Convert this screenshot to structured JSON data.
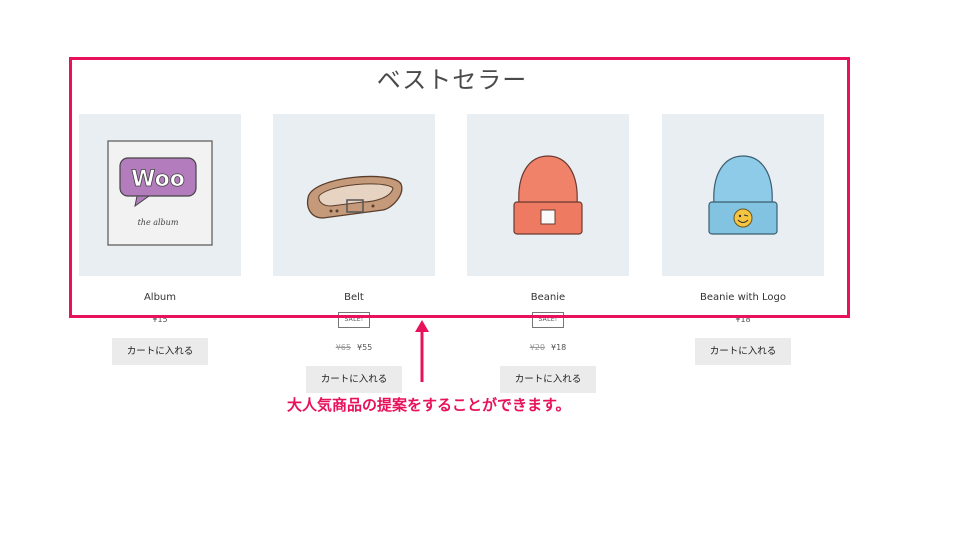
{
  "section": {
    "title": "ベストセラー"
  },
  "products": [
    {
      "name": "Album",
      "price": "¥15",
      "cart_label": "カートに入れる",
      "image_icon": "woo-album-icon"
    },
    {
      "name": "Belt",
      "sale_badge": "SALE!",
      "old_price": "¥65",
      "price": "¥55",
      "cart_label": "カートに入れる",
      "image_icon": "belt-icon"
    },
    {
      "name": "Beanie",
      "sale_badge": "SALE!",
      "old_price": "¥20",
      "price": "¥18",
      "cart_label": "カートに入れる",
      "image_icon": "beanie-orange-icon"
    },
    {
      "name": "Beanie with Logo",
      "price": "¥18",
      "cart_label": "カートに入れる",
      "image_icon": "beanie-blue-icon"
    }
  ],
  "album_art": {
    "logo_text": "Woo",
    "caption": "the album"
  },
  "annotation": {
    "text": "大人気商品の提案をすることができます。"
  },
  "colors": {
    "highlight": "#e8115b",
    "thumb_bg": "#e9eef2",
    "button_bg": "#ebebeb"
  }
}
